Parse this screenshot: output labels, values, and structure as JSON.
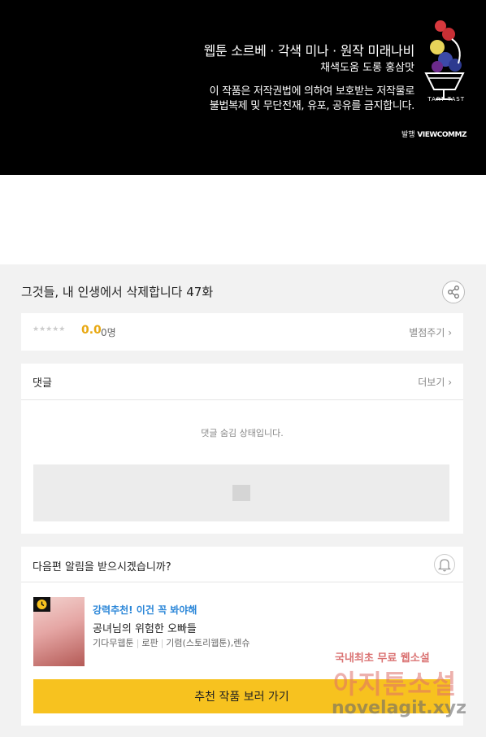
{
  "banner": {
    "credit_line1": "웹툰 소르베 · 각색 미나 · 원작 미래나비",
    "credit_line2": "채색도움 도롱 홍삼맛",
    "notice_line1": "이 작품은 저작권법에 의하여 보호받는 저작물로",
    "notice_line2": "불법복제 및 무단전재, 유포, 공유를 금지합니다.",
    "publisher_label": "발행",
    "publisher_name": "VIEWCOMMZ",
    "logo_text": "TART TAST"
  },
  "episode": {
    "title": "그것들, 내 인생에서 삭제합니다 47화",
    "share_icon": "share-icon"
  },
  "rating": {
    "stars": "★★★★★",
    "score": "0.0",
    "count": "0명",
    "rate_link": "별점주기 ›"
  },
  "comments": {
    "label": "댓글",
    "more": "더보기 ›",
    "hidden_message": "댓글 숨김 상태입니다."
  },
  "notify": {
    "question": "다음편 알림을 받으시겠습니까?",
    "recommendation_label": "강력추천! 이건 꼭 봐야해",
    "work_title": "공녀님의 위험한 오빠들",
    "meta": [
      "기다무웹툰",
      "로판",
      "기렴(스토리웹툰),렌슈"
    ],
    "cta": "추천 작품 보러 가기"
  },
  "watermark": {
    "line1": "국내최초 무료 웹소설",
    "line2": "아지툰소설",
    "line3": "novelagit.xyz"
  },
  "colors": {
    "accent_yellow": "#f7c21f",
    "score_orange": "#e8a812",
    "reco_blue": "#2a86d8"
  }
}
